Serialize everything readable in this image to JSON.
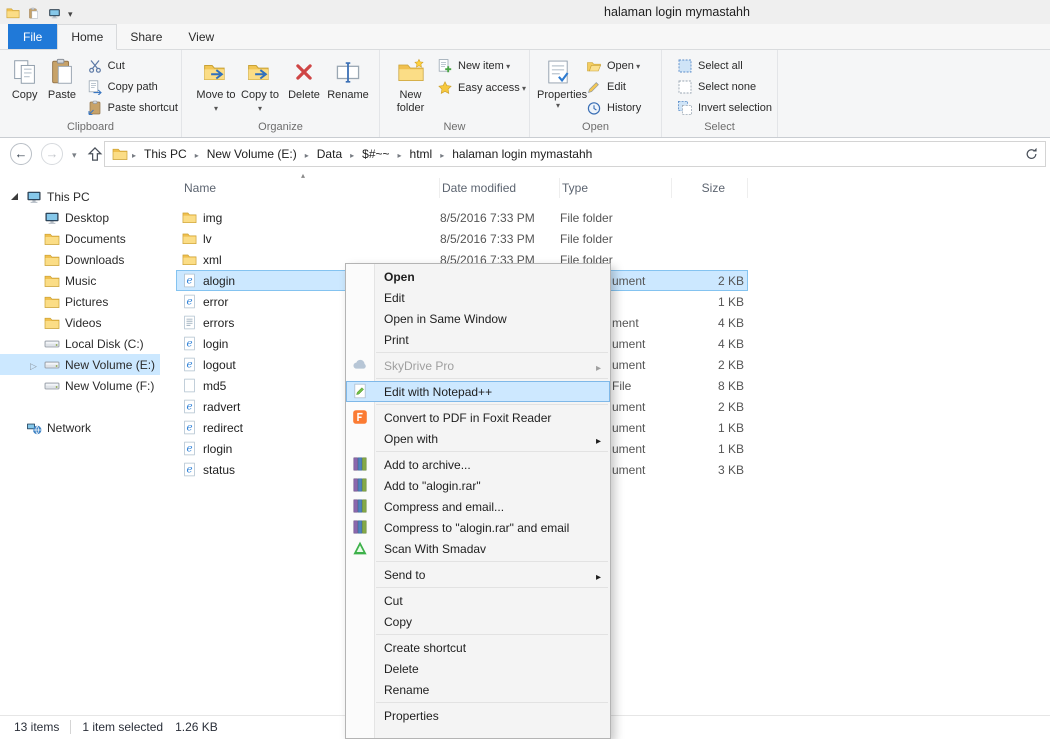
{
  "colors": {
    "file_tab_blue": "#2079d8",
    "selection_fill": "#cce8ff",
    "selection_border": "#84c3f0",
    "menu_highlight": "#cde8ff",
    "ribbon_bg": "#f5f6f7",
    "folder_yellow": "#f0c04f"
  },
  "titlebar": {
    "title": "halaman login mymastahh",
    "qat_icons": [
      "explorer-app-icon",
      "qat-paste-icon",
      "qat-computer-icon",
      "qat-customize-chevron-icon"
    ]
  },
  "tabs": [
    {
      "label": "File"
    },
    {
      "label": "Home",
      "active": true
    },
    {
      "label": "Share"
    },
    {
      "label": "View"
    }
  ],
  "ribbon": {
    "clipboard": {
      "group_label": "Clipboard",
      "copy": "Copy",
      "paste": "Paste",
      "cut": "Cut",
      "copy_path": "Copy path",
      "paste_shortcut": "Paste shortcut"
    },
    "organize": {
      "group_label": "Organize",
      "move_to": "Move to",
      "copy_to": "Copy to",
      "delete": "Delete",
      "rename": "Rename"
    },
    "new": {
      "group_label": "New",
      "new_folder": "New folder",
      "new_item": "New item",
      "easy_access": "Easy access"
    },
    "open": {
      "group_label": "Open",
      "properties": "Properties",
      "open": "Open",
      "edit": "Edit",
      "history": "History"
    },
    "select": {
      "group_label": "Select",
      "select_all": "Select all",
      "select_none": "Select none",
      "invert_selection": "Invert selection"
    }
  },
  "address_bar": {
    "breadcrumbs": [
      "This PC",
      "New Volume (E:)",
      "Data",
      "$#~~",
      "html",
      "halaman login mymastahh"
    ],
    "icons": [
      "back-arrow-icon",
      "forward-arrow-icon",
      "recent-locations-chevron-icon",
      "up-arrow-icon",
      "location-folder-icon",
      "refresh-icon"
    ]
  },
  "sidebar": {
    "items": [
      {
        "label": "This PC",
        "icon": "computer-icon",
        "expanded": true
      },
      {
        "label": "Desktop",
        "icon": "desktop-icon"
      },
      {
        "label": "Documents",
        "icon": "folder-icon"
      },
      {
        "label": "Downloads",
        "icon": "folder-icon"
      },
      {
        "label": "Music",
        "icon": "folder-icon"
      },
      {
        "label": "Pictures",
        "icon": "folder-icon"
      },
      {
        "label": "Videos",
        "icon": "folder-icon"
      },
      {
        "label": "Local Disk (C:)",
        "icon": "drive-icon"
      },
      {
        "label": "New Volume (E:)",
        "icon": "drive-icon",
        "selected": true
      },
      {
        "label": "New Volume (F:)",
        "icon": "drive-icon"
      },
      {
        "label": "Network",
        "icon": "network-icon"
      }
    ]
  },
  "file_list": {
    "columns": [
      "Name",
      "Date modified",
      "Type",
      "Size"
    ],
    "sort": {
      "column": "Name",
      "direction": "ascending"
    },
    "rows": [
      {
        "name": "img",
        "icon": "folder-icon",
        "date_modified": "8/5/2016 7:33 PM",
        "type": "File folder",
        "size": ""
      },
      {
        "name": "lv",
        "icon": "folder-icon",
        "date_modified": "8/5/2016 7:33 PM",
        "type": "File folder",
        "size": ""
      },
      {
        "name": "xml",
        "icon": "folder-icon",
        "date_modified": "8/5/2016 7:33 PM",
        "type": "File folder",
        "size": ""
      },
      {
        "name": "alogin",
        "icon": "html-file-icon",
        "type_partial": "ument",
        "size": "2 KB",
        "selected": true
      },
      {
        "name": "error",
        "icon": "html-file-icon",
        "type_partial": "",
        "size": "1 KB"
      },
      {
        "name": "errors",
        "icon": "text-file-icon",
        "type_partial": "ment",
        "size": "4 KB"
      },
      {
        "name": "login",
        "icon": "html-file-icon",
        "type_partial": "ument",
        "size": "4 KB"
      },
      {
        "name": "logout",
        "icon": "html-file-icon",
        "type_partial": "ument",
        "size": "2 KB"
      },
      {
        "name": "md5",
        "icon": "file-icon",
        "type_partial": "File",
        "size": "8 KB"
      },
      {
        "name": "radvert",
        "icon": "html-file-icon",
        "type_partial": "ument",
        "size": "2 KB"
      },
      {
        "name": "redirect",
        "icon": "html-file-icon",
        "type_partial": "ument",
        "size": "1 KB"
      },
      {
        "name": "rlogin",
        "icon": "html-file-icon",
        "type_partial": "ument",
        "size": "1 KB"
      },
      {
        "name": "status",
        "icon": "html-file-icon",
        "type_partial": "ument",
        "size": "3 KB"
      }
    ]
  },
  "context_menu": {
    "items": [
      {
        "label": "Open",
        "bold": true
      },
      {
        "label": "Edit"
      },
      {
        "label": "Open in Same Window"
      },
      {
        "label": "Print"
      },
      {
        "label": "SkyDrive Pro",
        "disabled": true,
        "submenu": true,
        "icon": "skydrive-cloud-icon"
      },
      {
        "label": "Edit with Notepad++",
        "highlighted": true,
        "icon": "notepad-plus-plus-icon"
      },
      {
        "label": "Convert to PDF in Foxit Reader",
        "icon": "foxit-pdf-icon"
      },
      {
        "label": "Open with",
        "submenu": true
      },
      {
        "label": "Add to archive...",
        "icon": "winrar-icon"
      },
      {
        "label": "Add to \"alogin.rar\"",
        "icon": "winrar-icon"
      },
      {
        "label": "Compress and email...",
        "icon": "winrar-icon"
      },
      {
        "label": "Compress to \"alogin.rar\" and email",
        "icon": "winrar-icon"
      },
      {
        "label": "Scan With Smadav",
        "icon": "smadav-icon"
      },
      {
        "label": "Send to",
        "submenu": true
      },
      {
        "label": "Cut"
      },
      {
        "label": "Copy"
      },
      {
        "label": "Create shortcut"
      },
      {
        "label": "Delete"
      },
      {
        "label": "Rename"
      },
      {
        "label": "Properties"
      }
    ]
  },
  "status_bar": {
    "item_count": "13 items",
    "selection_summary": "1 item selected",
    "selection_size": "1.26 KB"
  }
}
